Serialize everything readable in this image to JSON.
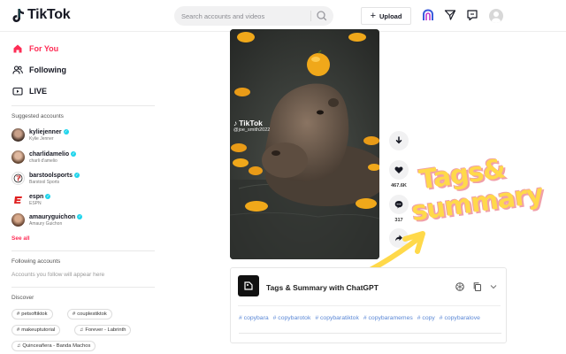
{
  "app": {
    "name": "TikTok"
  },
  "search": {
    "placeholder": "Search accounts and videos"
  },
  "header": {
    "upload_label": "Upload"
  },
  "nav": [
    {
      "label": "For You",
      "icon": "home-icon",
      "active": true
    },
    {
      "label": "Following",
      "icon": "people-icon",
      "active": false
    },
    {
      "label": "LIVE",
      "icon": "live-icon",
      "active": false
    }
  ],
  "suggested": {
    "title": "Suggested accounts",
    "accounts": [
      {
        "name": "kyliejenner",
        "sub": "Kylie Jenner",
        "verified": true
      },
      {
        "name": "charlidamelio",
        "sub": "charli d'amelio",
        "verified": true
      },
      {
        "name": "barstoolsports",
        "sub": "Barstool Sports",
        "verified": true
      },
      {
        "name": "espn",
        "sub": "ESPN",
        "verified": true
      },
      {
        "name": "amauryguichon",
        "sub": "Amaury Guichon",
        "verified": true
      }
    ],
    "see_all": "See all"
  },
  "following": {
    "title": "Following accounts",
    "empty": "Accounts you follow will appear here"
  },
  "discover": {
    "title": "Discover",
    "chips": [
      {
        "label": "petsoftiktok",
        "icon": "hash"
      },
      {
        "label": "couplestiktok",
        "icon": "hash"
      },
      {
        "label": "makeuptutorial",
        "icon": "hash"
      },
      {
        "label": "Forever - Labrinth",
        "icon": "music"
      },
      {
        "label": "Quinceañera - Banda Machos",
        "icon": "music"
      }
    ]
  },
  "video": {
    "watermark_brand": "TikTok",
    "watermark_user": "@joe_smith2022"
  },
  "actions": {
    "likes": "467.6K",
    "comments": "317"
  },
  "promo": {
    "line1": "Tags&",
    "line2": "summary"
  },
  "panel": {
    "title": "Tags & Summary with ChatGPT",
    "tags": [
      "# copybara",
      "# copybarotok",
      "# copybaratiktok",
      "# copybaramemes",
      "# copy",
      "# copybaralove"
    ]
  },
  "colors": {
    "brand_red": "#fe2c55",
    "tag_blue": "#5b88d6",
    "promo_yellow": "#ffd94a"
  }
}
